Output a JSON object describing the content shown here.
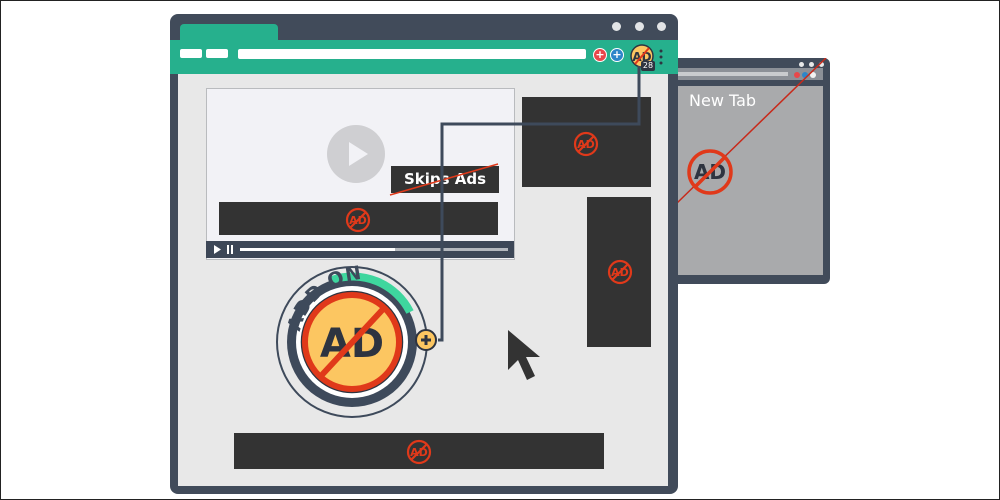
{
  "background_window": {
    "tab_title": "New Tab"
  },
  "video": {
    "skip_label": "Skips Ads"
  },
  "extension": {
    "badge_count": "28",
    "badge_text": "AD",
    "label": "ADD ON",
    "big_text": "AD"
  },
  "ad_placeholder": {
    "text": "AD"
  },
  "colors": {
    "toolbar": "#26b08d",
    "window_frame": "#414b5a",
    "ad_block": "#333333",
    "block_red": "#e0391a",
    "badge_yellow": "#fcc661",
    "addon_ring_green": "#3ed69e"
  }
}
